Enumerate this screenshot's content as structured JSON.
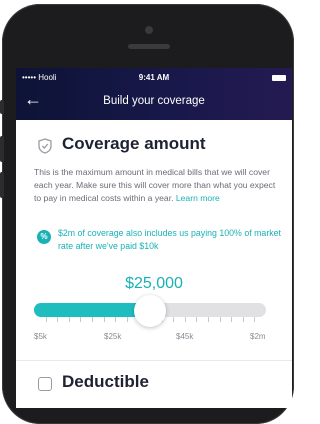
{
  "status_bar": {
    "carrier": "••••• Hooli",
    "time": "9:41 AM"
  },
  "nav": {
    "back_icon": "←",
    "title": "Build your coverage"
  },
  "coverage": {
    "heading": "Coverage amount",
    "description": "This is the maximum amount in medical bills that we will cover each year. Make sure this will cover more than what you expect to pay in medical costs within a year.",
    "learn_more": "Learn more",
    "note_icon": "%",
    "note": "$2m of coverage also includes us paying 100% of market rate after we've paid $10k",
    "selected_amount": "$25,000",
    "slider_level": 0.5,
    "slider_labels": [
      "$5k",
      "$25k",
      "$45k",
      "$2m"
    ]
  },
  "next_section": {
    "heading": "Deductible"
  },
  "colors": {
    "accent": "#1ab1b5",
    "nav_bg": "#15184a"
  }
}
